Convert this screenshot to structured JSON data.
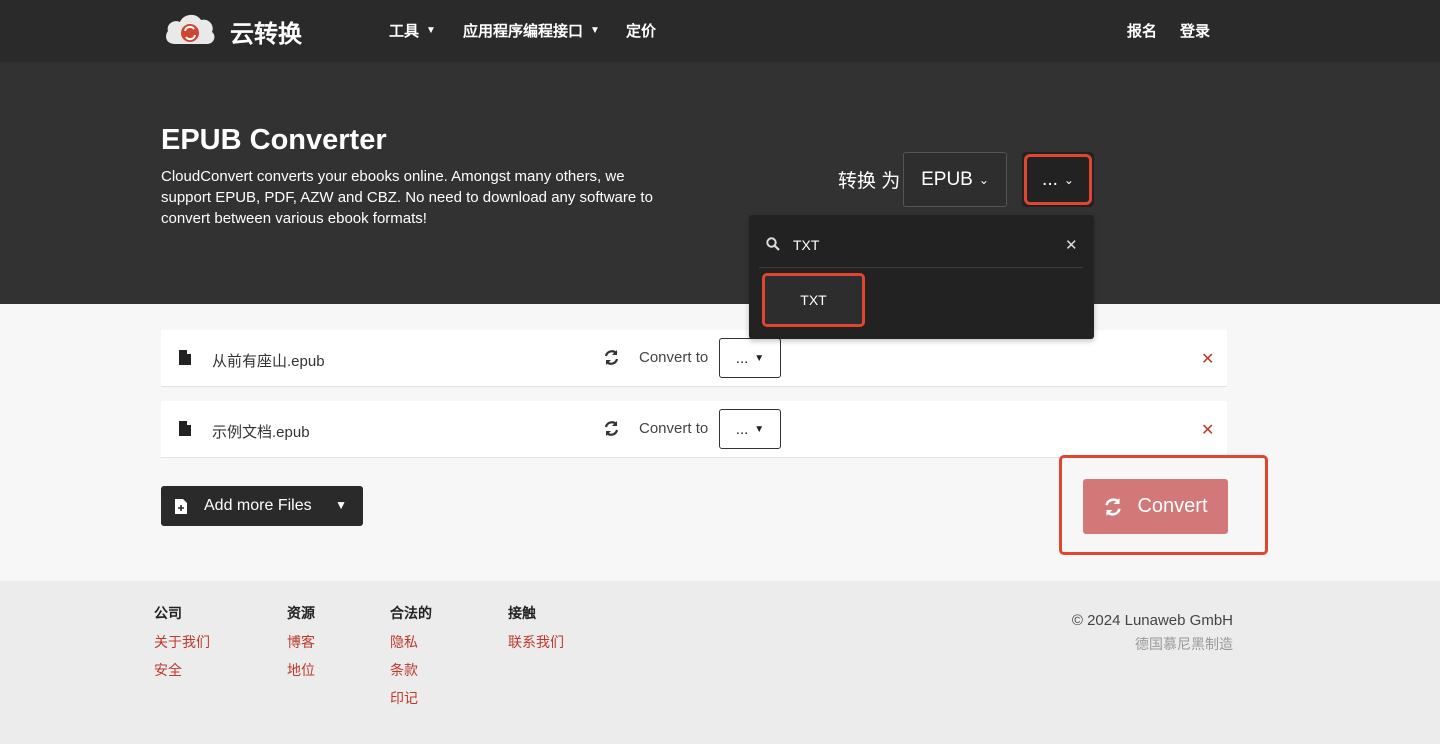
{
  "brand": {
    "name": "云转换"
  },
  "nav": {
    "tools": "工具",
    "api": "应用程序编程接口",
    "pricing": "定价",
    "signup": "报名",
    "login": "登录"
  },
  "hero": {
    "title": "EPUB Converter",
    "description": "CloudConvert converts your ebooks online. Amongst many others, we support EPUB, PDF, AZW and CBZ. No need to download any software to convert between various ebook formats!",
    "convert_label": "转换 为",
    "source_format": "EPUB",
    "target_format": "..."
  },
  "dropdown": {
    "search_value": "TXT",
    "options": [
      "TXT"
    ]
  },
  "files": [
    {
      "name": "从前有座山.epub",
      "convert_to_label": "Convert to",
      "target": "..."
    },
    {
      "name": "示例文档.epub",
      "convert_to_label": "Convert to",
      "target": "..."
    }
  ],
  "actions": {
    "add_files": "Add more Files",
    "convert": "Convert"
  },
  "footer": {
    "columns": [
      {
        "heading": "公司",
        "links": [
          "关于我们",
          "安全"
        ]
      },
      {
        "heading": "资源",
        "links": [
          "博客",
          "地位"
        ]
      },
      {
        "heading": "合法的",
        "links": [
          "隐私",
          "条款",
          "印记"
        ]
      },
      {
        "heading": "接触",
        "links": [
          "联系我们"
        ]
      }
    ],
    "copyright": "© 2024 Lunaweb GmbH",
    "made_in": "德国慕尼黑制造"
  },
  "colors": {
    "header_bg": "#323232",
    "highlight": "#e0452f",
    "convert_button": "#d27878",
    "link": "#c0392b"
  },
  "icons": [
    "cloud-logo-icon",
    "search-icon",
    "close-icon",
    "file-icon",
    "sync-icon",
    "remove-icon",
    "file-plus-icon",
    "chevron-down-icon",
    "refresh-icon"
  ]
}
